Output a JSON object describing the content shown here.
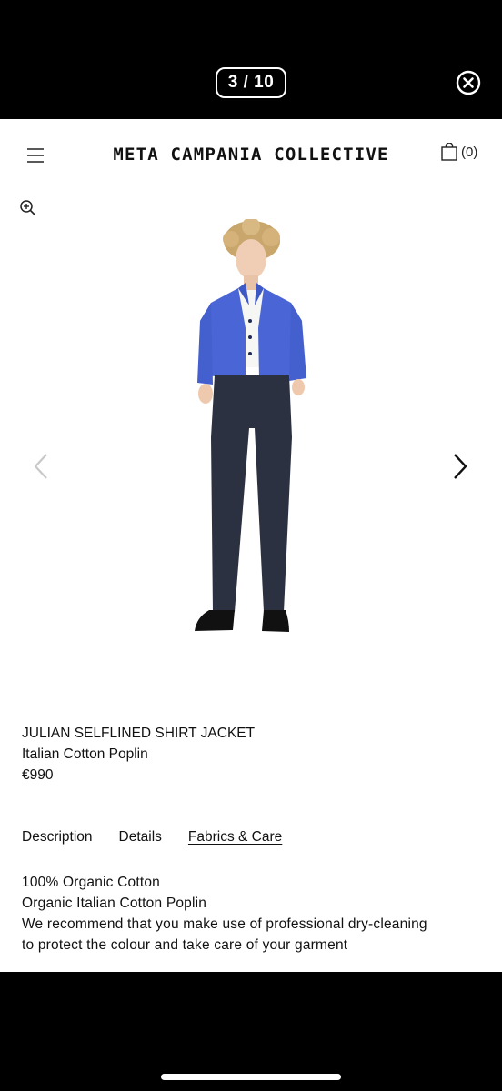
{
  "viewer": {
    "counter": "3 / 10"
  },
  "header": {
    "brand": "META CAMPANIA COLLECTIVE",
    "cart_count": "(0)"
  },
  "product": {
    "name": "JULIAN SELFLINED SHIRT JACKET",
    "subtitle": "Italian Cotton Poplin",
    "price": "€990"
  },
  "tabs": [
    {
      "label": "Description",
      "active": false
    },
    {
      "label": "Details",
      "active": false
    },
    {
      "label": "Fabrics & Care",
      "active": true
    }
  ],
  "fabrics_care": {
    "line1": "100% Organic Cotton",
    "line2": "Organic Italian Cotton Poplin",
    "line3": "We recommend that you make use of professional dry-cleaning",
    "line4": "to protect the colour and take care of your garment"
  },
  "colors": {
    "jacket": "#4a66d6",
    "trousers": "#2b3140",
    "background": "#ffffff",
    "chrome": "#000000"
  },
  "icons": [
    "close-icon",
    "menu-icon",
    "cart-icon",
    "zoom-icon",
    "chevron-left-icon",
    "chevron-right-icon"
  ]
}
